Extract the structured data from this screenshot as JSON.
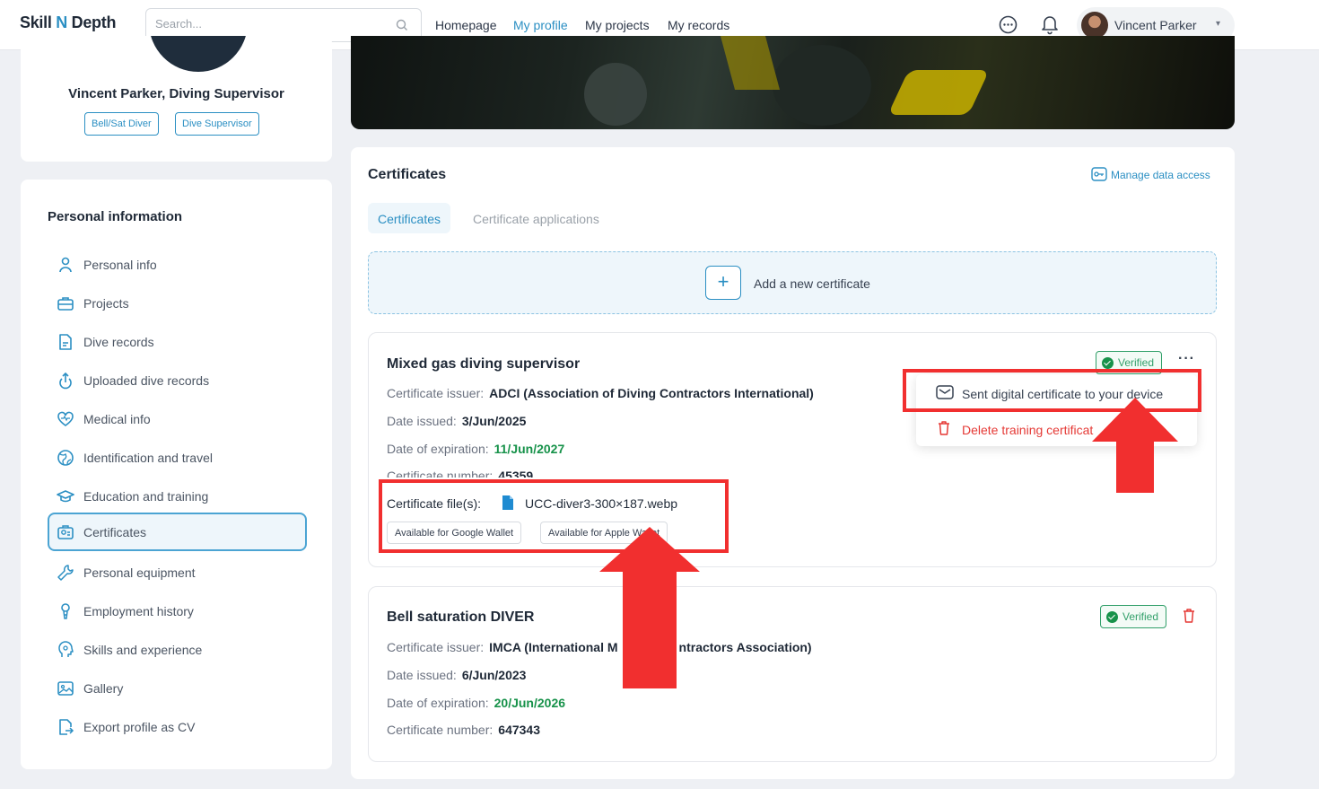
{
  "app": {
    "logo_prefix": "Skill ",
    "logo_n": "N",
    "logo_suffix": " Depth"
  },
  "search": {
    "placeholder": "Search..."
  },
  "nav": {
    "homepage": "Homepage",
    "my_profile": "My profile",
    "my_projects": "My projects",
    "my_records": "My records"
  },
  "user": {
    "name": "Vincent Parker"
  },
  "profile": {
    "name": "Vincent Parker, Diving Supervisor",
    "chips": [
      "Bell/Sat Diver",
      "Dive Supervisor"
    ]
  },
  "sidebar": {
    "title": "Personal information",
    "items": [
      {
        "label": "Personal info",
        "icon": "person-icon"
      },
      {
        "label": "Projects",
        "icon": "briefcase-icon"
      },
      {
        "label": "Dive records",
        "icon": "document-icon"
      },
      {
        "label": "Uploaded dive records",
        "icon": "upload-icon"
      },
      {
        "label": "Medical info",
        "icon": "heart-icon"
      },
      {
        "label": "Identification and travel",
        "icon": "globe-icon"
      },
      {
        "label": "Education and training",
        "icon": "graduation-cap-icon"
      },
      {
        "label": "Certificates",
        "icon": "certificate-icon"
      },
      {
        "label": "Personal equipment",
        "icon": "wrench-icon"
      },
      {
        "label": "Employment history",
        "icon": "medal-icon"
      },
      {
        "label": "Skills and experience",
        "icon": "head-icon"
      },
      {
        "label": "Gallery",
        "icon": "image-icon"
      },
      {
        "label": "Export profile as CV",
        "icon": "export-icon"
      }
    ],
    "active_index": 7
  },
  "certificates": {
    "section_title": "Certificates",
    "manage_link": "Manage data access",
    "tabs": [
      "Certificates",
      "Certificate applications"
    ],
    "add_label": "Add a new certificate",
    "labels": {
      "issuer": "Certificate issuer:",
      "issued": "Date issued:",
      "expiration": "Date of expiration:",
      "number": "Certificate number:",
      "files": "Certificate file(s):"
    },
    "items": [
      {
        "title": "Mixed gas diving supervisor",
        "issuer": "ADCI (Association of Diving Contractors International)",
        "issued": "3/Jun/2025",
        "expiration": "11/Jun/2027",
        "number": "45359",
        "file": "UCC-diver3-300×187.webp",
        "status": "Verified",
        "wallet_google": "Available for Google Wallet",
        "wallet_apple": "Available for Apple Wallet"
      },
      {
        "title": "Bell saturation DIVER",
        "issuer": "IMCA (International M",
        "issuer_tail": "ntractors Association)",
        "issued": "6/Jun/2023",
        "expiration": "20/Jun/2026",
        "number": "647343",
        "status": "Verified"
      }
    ],
    "menu": {
      "send": "Sent digital certificate to your device",
      "delete": "Delete training certificat"
    }
  },
  "colors": {
    "accent": "#2b8fc3",
    "verified": "#32a06a",
    "expiry": "#17924a",
    "danger": "#e53935",
    "annotation": "#f12f2f"
  }
}
